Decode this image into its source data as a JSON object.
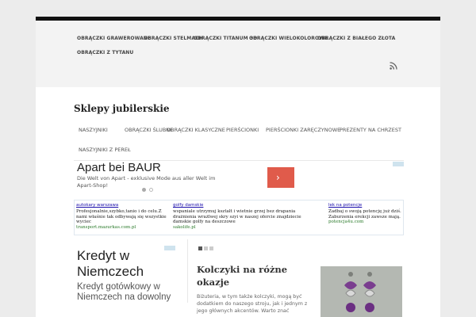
{
  "top_menu": {
    "items": [
      "OBRĄCZKI GRAWEROWANE",
      "OBRĄCZKI STELMACH",
      "OBRĄCZKI TITANUM 3D",
      "OBRĄCZKI WIELOKOLOROWE",
      "OBRĄCZKI Z BIAŁEGO ZŁOTA",
      "OBRĄCZKI Z TYTANU"
    ],
    "rss_icon": "rss-icon"
  },
  "site": {
    "title": "Sklepy jubilerskie"
  },
  "main_menu": {
    "items": [
      "NASZYJNIKI",
      "OBRĄCZKI ŚLUBNE",
      "OBRĄCZKI KLASYCZNE",
      "PIERŚCIONKI",
      "PIERŚCIONKI ZARĘCZYNOWE",
      "PREZENTY NA CHRZEST",
      "NASZYJNIKI Z PEREŁ"
    ]
  },
  "ad_banner": {
    "title": "Apart bei BAUR",
    "description": "Die Welt von Apart - exklusive Mode aus aller Welt im Apart-Shop!",
    "button_icon": "chevron-right-icon",
    "button_glyph": "›",
    "accent_color": "#e05b4b"
  },
  "text_ads": [
    {
      "title": "autokary warszawa",
      "text": "Profesjonalnie,szybko,tanio i do celu.Z nami właśnie tak odbywają się wszystkie wyciec",
      "url": "transport.mazurkas.com.pl"
    },
    {
      "title": "golfy damskie",
      "text": "wspaniale utrzymuj kształt i wietnie grzej bez drapania drażnienia wrażlwej skry szyi w naszej ofercie znajdziecie damskie golfy na deszczowe",
      "url": "sakolife.pl"
    },
    {
      "title": "lek na potencje",
      "text": "Zadbaj o swoją potencję już dziś. Zaburzenia erekcji zawsze mają.",
      "url": "potencja4u.com"
    }
  ],
  "side_ad": {
    "title": "Kredyt w Niemczech",
    "text": "Kredyt gotówkowy w Niemczech na dowolny cel. Kalkulator kredytowy"
  },
  "post": {
    "title": "Kolczyki na różne okazje",
    "excerpt": "Biżuteria, w tym także kolczyki, mogą być dodatkiem do naszego stroju, jak i jednym z jego głównych akcentów. Warto znać"
  }
}
